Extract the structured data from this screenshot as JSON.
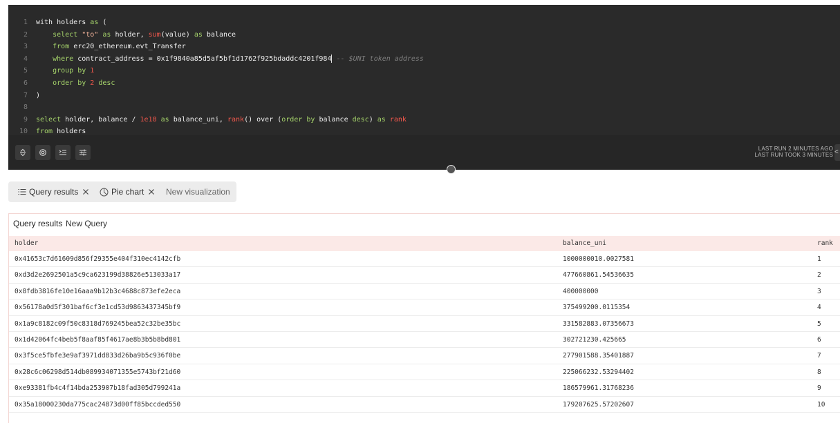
{
  "editor": {
    "lines": [
      {
        "n": "1",
        "tokens": [
          {
            "t": "with holders ",
            "c": "id"
          },
          {
            "t": "as",
            "c": "kw"
          },
          {
            "t": " (",
            "c": "id"
          }
        ]
      },
      {
        "n": "2",
        "tokens": [
          {
            "t": "    ",
            "c": "id"
          },
          {
            "t": "select",
            "c": "kw"
          },
          {
            "t": " ",
            "c": "id"
          },
          {
            "t": "\"to\"",
            "c": "str"
          },
          {
            "t": " ",
            "c": "id"
          },
          {
            "t": "as",
            "c": "kw"
          },
          {
            "t": " holder, ",
            "c": "id"
          },
          {
            "t": "sum",
            "c": "fn"
          },
          {
            "t": "(value) ",
            "c": "id"
          },
          {
            "t": "as",
            "c": "kw"
          },
          {
            "t": " balance",
            "c": "id"
          }
        ]
      },
      {
        "n": "3",
        "tokens": [
          {
            "t": "    ",
            "c": "id"
          },
          {
            "t": "from",
            "c": "kw"
          },
          {
            "t": " erc20_ethereum.evt_Transfer",
            "c": "id"
          }
        ]
      },
      {
        "n": "4",
        "tokens": [
          {
            "t": "    ",
            "c": "id"
          },
          {
            "t": "where",
            "c": "kw"
          },
          {
            "t": " contract_address = 0x1f9840a85d5af5bf1d1762f925bdaddc4201f984",
            "c": "id"
          },
          {
            "t": "",
            "c": "cursor"
          },
          {
            "t": " -- $UNI token address",
            "c": "cm"
          }
        ]
      },
      {
        "n": "5",
        "tokens": [
          {
            "t": "    ",
            "c": "id"
          },
          {
            "t": "group by",
            "c": "kw"
          },
          {
            "t": " ",
            "c": "id"
          },
          {
            "t": "1",
            "c": "num"
          }
        ]
      },
      {
        "n": "6",
        "tokens": [
          {
            "t": "    ",
            "c": "id"
          },
          {
            "t": "order by",
            "c": "kw"
          },
          {
            "t": " ",
            "c": "id"
          },
          {
            "t": "2",
            "c": "num"
          },
          {
            "t": " ",
            "c": "id"
          },
          {
            "t": "desc",
            "c": "kw"
          }
        ]
      },
      {
        "n": "7",
        "tokens": [
          {
            "t": ")",
            "c": "id"
          }
        ]
      },
      {
        "n": "8",
        "tokens": []
      },
      {
        "n": "9",
        "tokens": [
          {
            "t": "select",
            "c": "kw"
          },
          {
            "t": " holder, balance / ",
            "c": "id"
          },
          {
            "t": "1e18",
            "c": "num"
          },
          {
            "t": " ",
            "c": "id"
          },
          {
            "t": "as",
            "c": "kw"
          },
          {
            "t": " balance_uni, ",
            "c": "id"
          },
          {
            "t": "rank",
            "c": "fn"
          },
          {
            "t": "() over (",
            "c": "id"
          },
          {
            "t": "order by",
            "c": "kw"
          },
          {
            "t": " balance ",
            "c": "id"
          },
          {
            "t": "desc",
            "c": "kw"
          },
          {
            "t": ") ",
            "c": "id"
          },
          {
            "t": "as",
            "c": "kw"
          },
          {
            "t": " ",
            "c": "id"
          },
          {
            "t": "rank",
            "c": "fn"
          }
        ]
      },
      {
        "n": "10",
        "tokens": [
          {
            "t": "from",
            "c": "kw"
          },
          {
            "t": " holders",
            "c": "id"
          }
        ]
      }
    ],
    "run_info": {
      "line1": "LAST RUN 2 MINUTES AGO",
      "line2": "LAST RUN TOOK 3 MINUTES"
    },
    "toolbar_icons": [
      "expand-collapse-icon",
      "settings-icon",
      "format-icon",
      "parameters-icon"
    ],
    "edge_button_glyph": "<"
  },
  "tabs": [
    {
      "label": "Query results",
      "icon": "list-icon",
      "closable": true,
      "active": true
    },
    {
      "label": "Pie chart",
      "icon": "pie-chart-icon",
      "closable": true,
      "active": false
    },
    {
      "label": "New visualization",
      "icon": "",
      "closable": false,
      "active": false
    }
  ],
  "results": {
    "title": "Query results",
    "subtitle": "New Query",
    "columns": [
      "holder",
      "balance_uni",
      "rank"
    ],
    "rows": [
      [
        "0x41653c7d61609d856f29355e404f310ec4142cfb",
        "1000000010.0027581",
        "1"
      ],
      [
        "0xd3d2e2692501a5c9ca623199d38826e513033a17",
        "477660861.54536635",
        "2"
      ],
      [
        "0x8fdb3816fe10e16aaa9b12b3c4688c873efe2eca",
        "400000000",
        "3"
      ],
      [
        "0x56178a0d5f301baf6cf3e1cd53d9863437345bf9",
        "375499200.0115354",
        "4"
      ],
      [
        "0x1a9c8182c09f50c8318d769245bea52c32be35bc",
        "331582883.07356673",
        "5"
      ],
      [
        "0x1d42064fc4beb5f8aaf85f4617ae8b3b5b8bd801",
        "302721230.425665",
        "6"
      ],
      [
        "0x3f5ce5fbfe3e9af3971dd833d26ba9b5c936f0be",
        "277901588.35401887",
        "7"
      ],
      [
        "0x28c6c06298d514db089934071355e5743bf21d60",
        "225066232.53294402",
        "8"
      ],
      [
        "0xe93381fb4c4f14bda253907b18fad305d799241a",
        "186579961.31768236",
        "9"
      ],
      [
        "0x35a18000230da775cac24873d00ff85bccded550",
        "179207625.57202607",
        "10"
      ]
    ]
  },
  "colors": {
    "editor_bg": "#2a2a2a",
    "keyword": "#a6d46b",
    "function": "#f0574c",
    "number": "#f0574c",
    "comment": "#7f7f7f",
    "header_bg": "#fbe9e7"
  }
}
